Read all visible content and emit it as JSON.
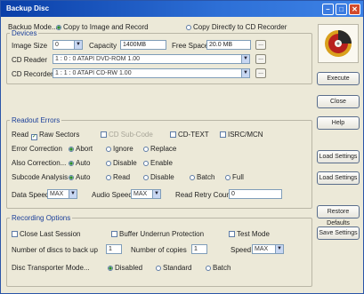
{
  "window": {
    "title": "Backup Disc"
  },
  "backup_mode": {
    "label": "Backup Mode...",
    "options": [
      "Copy to Image and Record",
      "Copy Directly to CD Recorder"
    ],
    "selected": 0
  },
  "devices": {
    "group_title": "Devices",
    "image_size_label": "Image Size",
    "image_size_value": "0",
    "capacity_label": "Capacity",
    "capacity_value": "1400MB",
    "free_space_label": "Free Space",
    "free_space_value": "20.0 MB",
    "cd_reader_label": "CD Reader",
    "cd_reader_value": "1 : 0 : 0   ATAPI   DVD-ROM   1.00",
    "cd_recorder_label": "CD Recorder",
    "cd_recorder_value": "1 : 1 : 0   ATAPI   CD-RW   1.00",
    "browse_label": "..."
  },
  "readout": {
    "group_title": "Readout Errors",
    "read_label": "Read",
    "read_options": [
      "Raw Sectors",
      "CD Sub-Code",
      "CD-TEXT",
      "ISRC/MCN"
    ],
    "read_checked": [
      true,
      false,
      false,
      false
    ],
    "read_disabled": [
      false,
      true,
      false,
      false
    ],
    "correct_label": "Error Correction",
    "correct_options": [
      "Abort",
      "Ignore",
      "Replace"
    ],
    "correct_selected": 0,
    "also_label": "Also Correction...",
    "also_options": [
      "Auto",
      "Disable",
      "Enable"
    ],
    "also_selected": 0,
    "subcode_label": "Subcode Analysis",
    "subcode_options": [
      "Auto",
      "Read",
      "Disable",
      "Batch",
      "Full"
    ],
    "subcode_selected": 0,
    "data_speed_label": "Data Speed",
    "data_speed_value": "MAX",
    "audio_speed_label": "Audio Speed",
    "audio_speed_value": "MAX",
    "retry_label": "Read Retry Count",
    "retry_value": "0"
  },
  "recording": {
    "group_title": "Recording Options",
    "opts": [
      "Close Last Session",
      "Buffer Underrun Protection",
      "Test Mode"
    ],
    "opts_checked": [
      false,
      false,
      false
    ],
    "copies_label": "Number of discs to back up",
    "copies_value": "1",
    "copies2_label": "Number of copies",
    "copies2_value": "1",
    "speed_label": "Speed",
    "speed_value": "MAX",
    "disc_label": "Disc Transporter Mode...",
    "disc_options": [
      "Disabled",
      "Standard",
      "Batch"
    ],
    "disc_selected": 0
  },
  "buttons": {
    "execute": "Execute",
    "close": "Close",
    "help": "Help",
    "load_set": "Load Settings",
    "load_set2": "Load Settings",
    "restore": "Restore Defaults",
    "save": "Save Settings"
  },
  "icons": {
    "logo": "disc-logo-icon",
    "minimize": "minimize-icon",
    "maximize": "maximize-icon",
    "close": "close-icon"
  }
}
